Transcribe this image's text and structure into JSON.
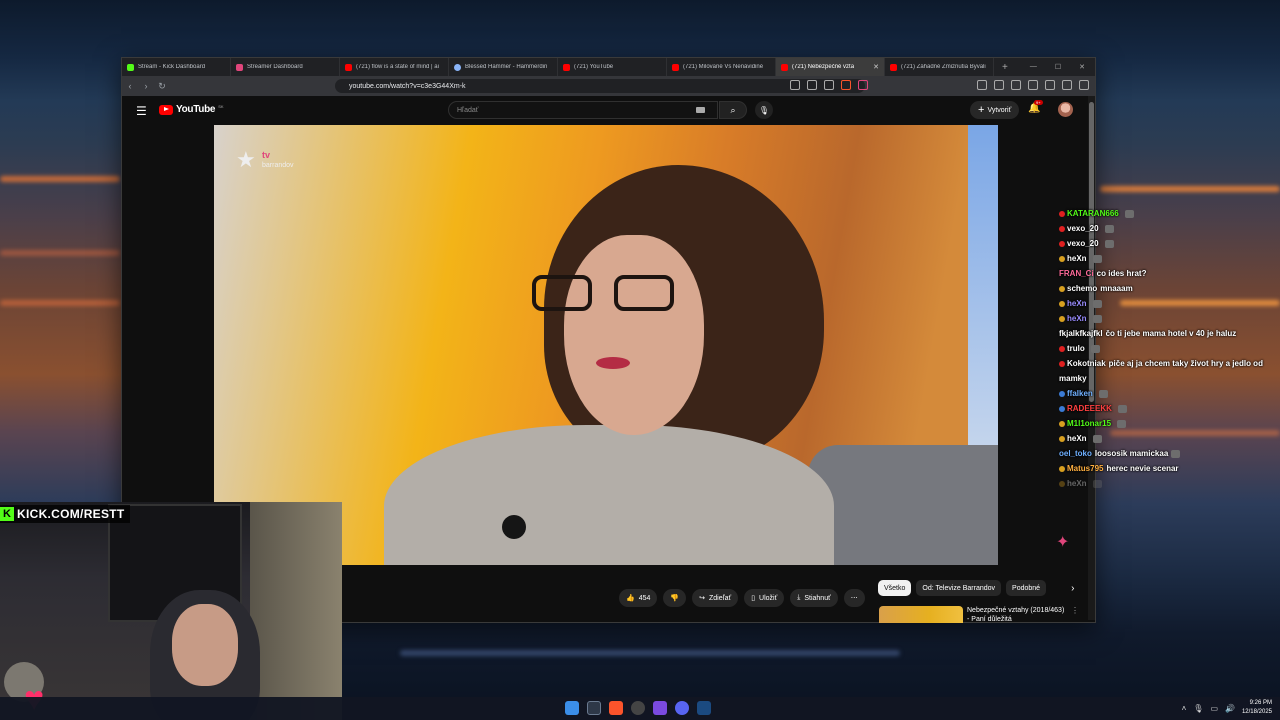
{
  "browser": {
    "tabs": [
      {
        "label": "Stream - Kick Dashboard",
        "icon": "kick",
        "active": false
      },
      {
        "label": "Streamer Dashboard",
        "icon": "pink",
        "active": false
      },
      {
        "label": "(721) flow is a state of mind | ai",
        "icon": "yt",
        "active": false
      },
      {
        "label": "Blessed Hammer - Hammerdin",
        "icon": "shield",
        "active": false
      },
      {
        "label": "(721) YouTube",
        "icon": "yt",
        "active": false
      },
      {
        "label": "(721) Milované Vs Nenávidiné",
        "icon": "yt",
        "active": false
      },
      {
        "label": "(721) Nebezpečné vzta",
        "icon": "yt",
        "active": true
      },
      {
        "label": "(721) Záhadné Zmiznutia Byvali",
        "icon": "yt",
        "active": false
      }
    ],
    "new_tab": "+",
    "url": "youtube.com/watch?v=c3e3G44Xm-k"
  },
  "youtube": {
    "logo_text": "YouTube",
    "logo_region": "SK",
    "search_placeholder": "Hľadať",
    "create_label": "Vytvoriť",
    "notifications_badge": "9+",
    "video_channel_logo": {
      "tv": "tv",
      "brand": "barrandov"
    },
    "actions": {
      "like_count": "454",
      "share": "Zdieľať",
      "save": "Uložiť",
      "download": "Stiahnuť"
    },
    "chips": [
      "Všetko",
      "Od: Televize Barrandov",
      "Podobné"
    ],
    "recommendation": {
      "title": "Nebezpečné vztahy (2018/463) - Paní důležitá"
    }
  },
  "chat": [
    {
      "user": "KATARAN666",
      "text": "",
      "color": "#53fc18",
      "dot": "#e02020",
      "emote": true
    },
    {
      "user": "vexo_20",
      "text": "",
      "color": "#ffffff",
      "dot": "#e02020",
      "emote": true
    },
    {
      "user": "vexo_20",
      "text": "",
      "color": "#ffffff",
      "dot": "#e02020",
      "emote": true
    },
    {
      "user": "heXn",
      "text": "",
      "color": "#ffffff",
      "dot": "#d8a020",
      "emote": true
    },
    {
      "user": "FRAN_Ci",
      "text": "co ides hrat?",
      "color": "#ff6b9a",
      "dot": "",
      "emote": false
    },
    {
      "user": "schemo",
      "text": "mnaaam",
      "color": "#ffffff",
      "dot": "#d8a020",
      "emote": false
    },
    {
      "user": "heXn",
      "text": "",
      "color": "#9a8cff",
      "dot": "#d8a020",
      "emote": true
    },
    {
      "user": "heXn",
      "text": "",
      "color": "#9a8cff",
      "dot": "#d8a020",
      "emote": true
    },
    {
      "user": "fkjalkfkajfkl",
      "text": "čo ti jebe mama hotel v 40 je haluz",
      "color": "#ffffff",
      "dot": "",
      "emote": false
    },
    {
      "user": "trulo",
      "text": "",
      "color": "#ffffff",
      "dot": "#e02020",
      "emote": true
    },
    {
      "user": "Kokotniak",
      "text": "piče aj ja chcem taky život hry a jedlo od mamky",
      "color": "#ffffff",
      "dot": "#e02020",
      "emote": false
    },
    {
      "user": "ffalken",
      "text": "",
      "color": "#6fb0ff",
      "dot": "#3a7bd5",
      "emote": true
    },
    {
      "user": "RADEEEKK",
      "text": "",
      "color": "#ff4040",
      "dot": "#3a7bd5",
      "emote": true
    },
    {
      "user": "M1l1onar15",
      "text": "",
      "color": "#53fc18",
      "dot": "#d8a020",
      "emote": true
    },
    {
      "user": "heXn",
      "text": "",
      "color": "#ffffff",
      "dot": "#d8a020",
      "emote": true
    },
    {
      "user": "oel_toko",
      "text": "loososik mamickaa",
      "color": "#6fb0ff",
      "dot": "",
      "emote": true
    },
    {
      "user": "Matus795",
      "text": "herec nevie scenar",
      "color": "#ffb040",
      "dot": "#d8a020",
      "emote": false
    },
    {
      "user": "heXn",
      "text": "",
      "color": "#ffffff",
      "dot": "#d8a020",
      "emote": true,
      "faded": true
    }
  ],
  "overlay": {
    "kick_url": "KICK.COM/RESTT"
  },
  "taskbar": {
    "time": "9:26 PM",
    "date": "12/18/2025"
  }
}
